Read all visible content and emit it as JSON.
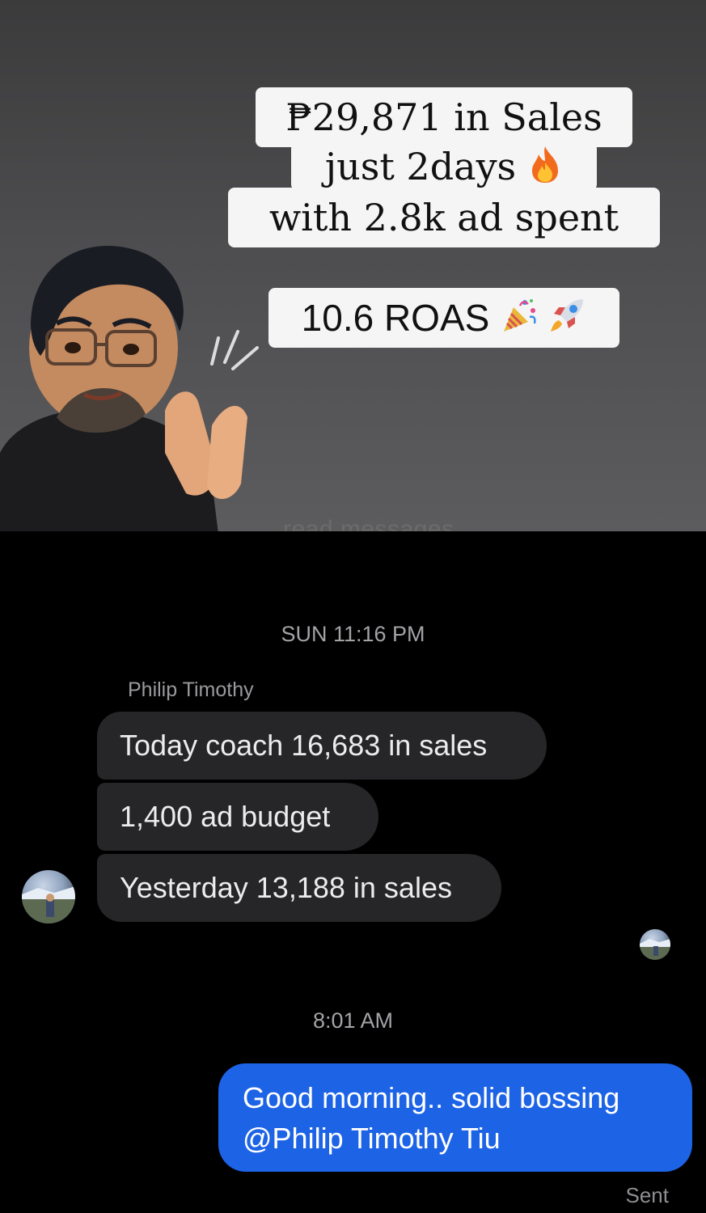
{
  "story": {
    "headline_line1": "₱29,871 in Sales",
    "headline_line2": "just 2days",
    "headline_line3": "with 2.8k ad spent",
    "roas": "10.6 ROAS",
    "partial_text": "read messages",
    "icons": [
      "fire-icon",
      "party-popper-icon",
      "rocket-icon"
    ]
  },
  "chat": {
    "timestamp1": "SUN 11:16 PM",
    "sender_name": "Philip Timothy",
    "messages": [
      "Today coach 16,683 in sales",
      "1,400 ad budget",
      "Yesterday 13,188 in sales"
    ],
    "timestamp2": "8:01 AM",
    "reply_line1": "Good morning.. solid bossing",
    "reply_line2": "@Philip Timothy Tiu",
    "status": "Sent",
    "colors": {
      "sent_bubble": "#1d63e6",
      "received_bubble": "#262628",
      "background": "#000000"
    }
  }
}
